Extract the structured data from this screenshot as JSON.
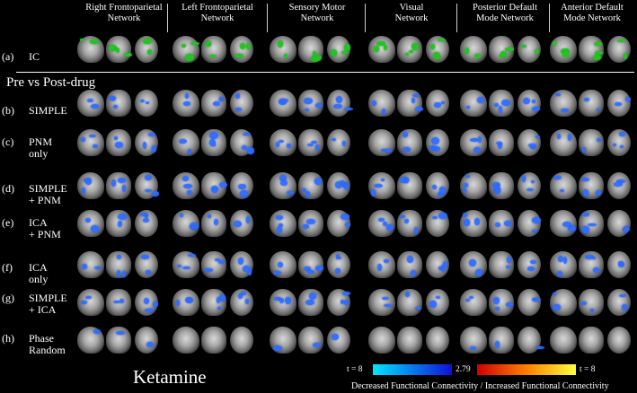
{
  "networks": [
    {
      "line1": "Right Frontoparietal",
      "line2": "Network"
    },
    {
      "line1": "Left Frontoparietal",
      "line2": "Network"
    },
    {
      "line1": "Sensory Motor",
      "line2": "Network"
    },
    {
      "line1": "Visual",
      "line2": "Network"
    },
    {
      "line1": "Posterior Default",
      "line2": "Mode Network"
    },
    {
      "line1": "Anterior Default",
      "line2": "Mode Network"
    }
  ],
  "section_label": "Pre vs Post-drug",
  "rows": [
    {
      "index": "(a)",
      "line1": "IC",
      "line2": ""
    },
    {
      "index": "(b)",
      "line1": "SIMPLE",
      "line2": ""
    },
    {
      "index": "(c)",
      "line1": "PNM",
      "line2": "only"
    },
    {
      "index": "(d)",
      "line1": "SIMPLE",
      "line2": "+ PNM"
    },
    {
      "index": "(e)",
      "line1": "ICA",
      "line2": "+ PNM"
    },
    {
      "index": "(f)",
      "line1": "ICA",
      "line2": "only"
    },
    {
      "index": "(g)",
      "line1": "SIMPLE",
      "line2": "+ ICA"
    },
    {
      "index": "(h)",
      "line1": "Phase",
      "line2": "Random"
    }
  ],
  "drug_label": "Ketamine",
  "colorbar": {
    "left_label": "t = 8",
    "threshold_label": "2.79",
    "right_label": "t = 8",
    "decreased_color_start": "#00e5ff",
    "decreased_color_end": "#1010d8",
    "increased_color_start": "#d00000",
    "increased_color_end": "#ffff40",
    "legend": "Decreased Functional Connectivity / Increased Functional Connectivity"
  },
  "overlay_colors": {
    "ic": "#22c422",
    "decrease": "#2f6cff"
  }
}
